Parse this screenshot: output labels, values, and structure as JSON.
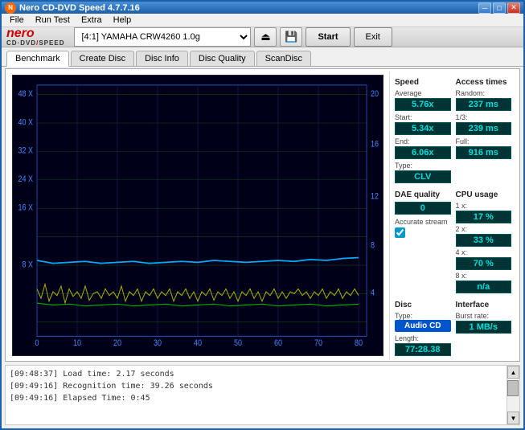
{
  "titleBar": {
    "title": "Nero CD-DVD Speed 4.7.7.16",
    "icon": "●",
    "minBtn": "─",
    "maxBtn": "□",
    "closeBtn": "✕"
  },
  "menuBar": {
    "items": [
      "File",
      "Run Test",
      "Extra",
      "Help"
    ]
  },
  "toolbar": {
    "logo": {
      "nero": "nero",
      "cdspeed": "CD·DVD/SPEED"
    },
    "driveLabel": "[4:1]  YAMAHA CRW4260 1.0g",
    "startLabel": "Start",
    "exitLabel": "Exit"
  },
  "tabs": {
    "items": [
      "Benchmark",
      "Create Disc",
      "Disc Info",
      "Disc Quality",
      "ScanDisc"
    ],
    "active": "Benchmark"
  },
  "chart": {
    "yLabels": [
      "48 X",
      "40 X",
      "32 X",
      "24 X",
      "16 X",
      "8 X"
    ],
    "yLabelsRight": [
      "20",
      "16",
      "12",
      "8",
      "4"
    ],
    "xLabels": [
      "0",
      "10",
      "20",
      "30",
      "40",
      "50",
      "60",
      "70",
      "80"
    ]
  },
  "stats": {
    "speed": {
      "title": "Speed",
      "average": {
        "label": "Average",
        "value": "5.76x"
      },
      "start": {
        "label": "Start:",
        "value": "5.34x"
      },
      "end": {
        "label": "End:",
        "value": "6.06x"
      },
      "type": {
        "label": "Type:",
        "value": "CLV"
      }
    },
    "daeQuality": {
      "title": "DAE quality",
      "value": "0"
    },
    "accurateStream": {
      "label": "Accurate stream",
      "checked": true
    },
    "disc": {
      "title": "Disc",
      "typeLabel": "Type:",
      "typeValue": "Audio CD",
      "lengthLabel": "Length:",
      "lengthValue": "77:28.38"
    },
    "accessTimes": {
      "title": "Access times",
      "random": {
        "label": "Random:",
        "value": "237 ms"
      },
      "oneThird": {
        "label": "1/3:",
        "value": "239 ms"
      },
      "full": {
        "label": "Full:",
        "value": "916 ms"
      }
    },
    "cpuUsage": {
      "title": "CPU usage",
      "oneX": {
        "label": "1 x:",
        "value": "17 %"
      },
      "twoX": {
        "label": "2 x:",
        "value": "33 %"
      },
      "fourX": {
        "label": "4 x:",
        "value": "70 %"
      },
      "eightX": {
        "label": "8 x:",
        "value": "n/a"
      }
    },
    "interface": {
      "title": "Interface",
      "burstRate": {
        "label": "Burst rate:",
        "value": "1 MB/s"
      }
    }
  },
  "log": {
    "lines": [
      "[09:48:37]  Load time: 2.17 seconds",
      "[09:49:16]  Recognition time: 39.26 seconds",
      "[09:49:16]  Elapsed Time: 0:45"
    ]
  }
}
